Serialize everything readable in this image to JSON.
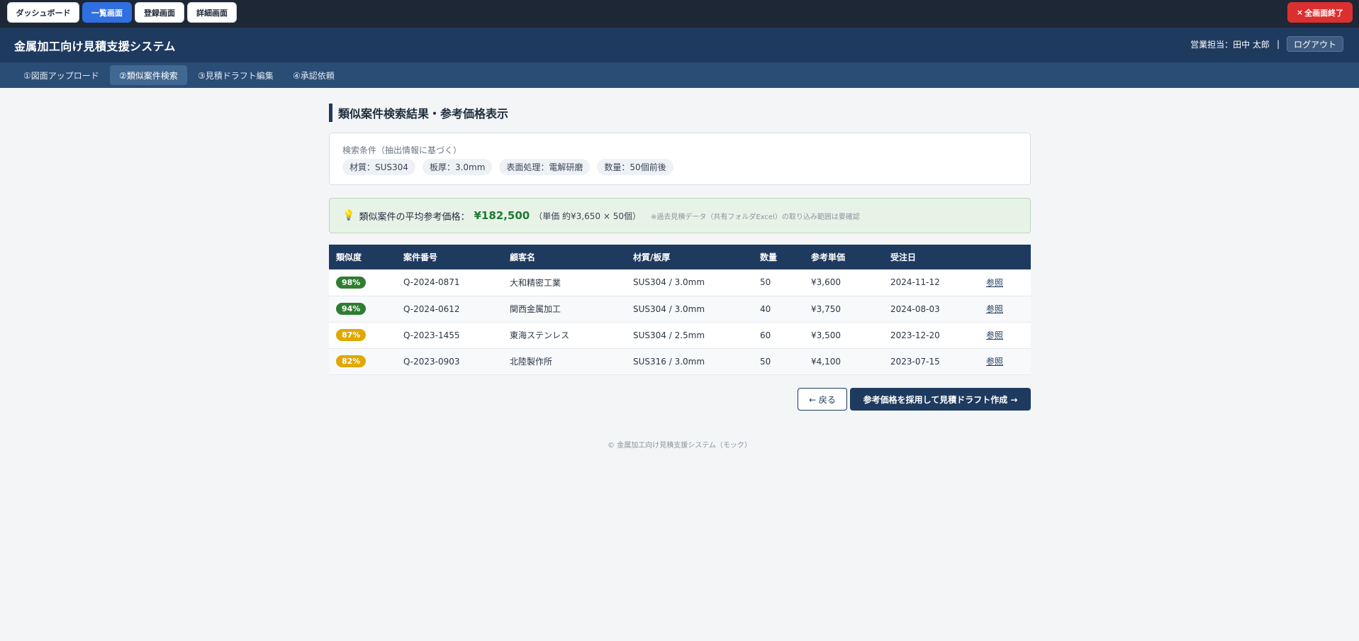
{
  "switcher": {
    "buttons": [
      "ダッシュボード",
      "一覧画面",
      "登録画面",
      "詳細画面"
    ],
    "active_index": 1,
    "exit_label": "全画面終了",
    "exit_icon": "×"
  },
  "header": {
    "title": "金属加工向け見積支援システム",
    "user_label": "営業担当：田中 太郎",
    "separator": "|",
    "logout_label": "ログアウト"
  },
  "steps": {
    "items": [
      "①図面アップロード",
      "②類似案件検索",
      "③見積ドラフト編集",
      "④承認依頼"
    ],
    "active_index": 1
  },
  "main": {
    "title": "類似案件検索結果・参考価格表示",
    "conditions": {
      "label": "検索条件（抽出情報に基づく）",
      "chips": [
        "材質：SUS304",
        "板厚：3.0mm",
        "表面処理：電解研磨",
        "数量：50個前後"
      ]
    },
    "average": {
      "icon": "💡",
      "label": "類似案件の平均参考価格：",
      "value": "¥182,500",
      "detail": "（単価 約¥3,650 × 50個）",
      "note": "※過去見積データ（共有フォルダExcel）の取り込み範囲は要確認"
    },
    "table": {
      "headers": [
        "類似度",
        "案件番号",
        "顧客名",
        "材質/板厚",
        "数量",
        "参考単価",
        "受注日",
        ""
      ],
      "rows": [
        {
          "similarity": "98%",
          "badge_color": "#2e7d32",
          "case_no": "Q-2024-0871",
          "customer": "大和精密工業",
          "material": "SUS304 / 3.0mm",
          "qty": "50",
          "unit_price": "¥3,600",
          "date": "2024-11-12",
          "link": "参照"
        },
        {
          "similarity": "94%",
          "badge_color": "#2e7d32",
          "case_no": "Q-2024-0612",
          "customer": "関西金属加工",
          "material": "SUS304 / 3.0mm",
          "qty": "40",
          "unit_price": "¥3,750",
          "date": "2024-08-03",
          "link": "参照"
        },
        {
          "similarity": "87%",
          "badge_color": "#e0a800",
          "case_no": "Q-2023-1455",
          "customer": "東海ステンレス",
          "material": "SUS304 / 2.5mm",
          "qty": "60",
          "unit_price": "¥3,500",
          "date": "2023-12-20",
          "link": "参照"
        },
        {
          "similarity": "82%",
          "badge_color": "#e0a800",
          "case_no": "Q-2023-0903",
          "customer": "北陸製作所",
          "material": "SUS316 / 3.0mm",
          "qty": "50",
          "unit_price": "¥4,100",
          "date": "2023-07-15",
          "link": "参照"
        }
      ]
    },
    "buttons": {
      "back_label": "← 戻る",
      "adopt_label": "参考価格を採用して見積ドラフト作成 →"
    }
  },
  "footer": "© 金属加工向け見積支援システム（モック）"
}
